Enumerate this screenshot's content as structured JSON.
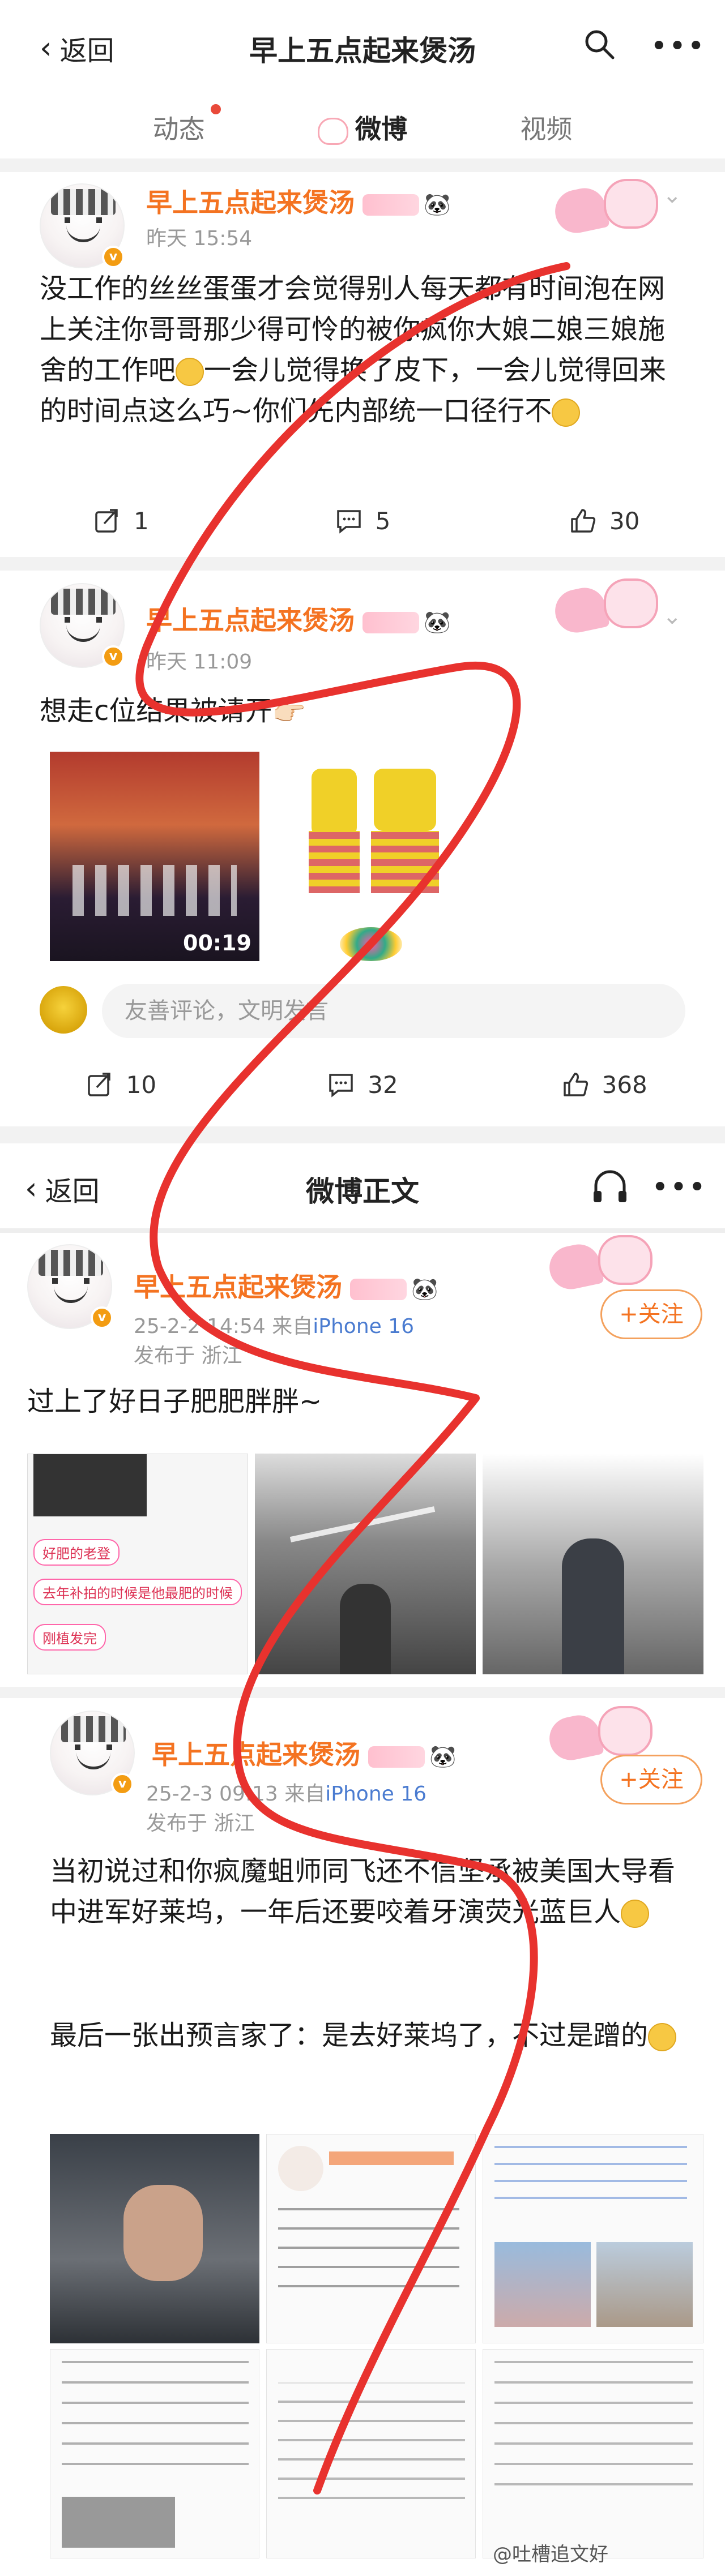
{
  "topbar": {
    "back_label": "返回",
    "title": "早上五点起来煲汤"
  },
  "tabs": [
    "动态",
    "微博",
    "视频"
  ],
  "posts": [
    {
      "author": "早上五点起来煲汤",
      "time": "昨天 15:54",
      "text": "没工作的丝丝蛋蛋才会觉得别人每天都有时间泡在网上关注你哥哥那少得可怜的被你疯你大娘二娘三娘施舍的工作吧",
      "text2": "一会儿觉得换了皮下，一会儿觉得回来的时间点这么巧~你们先内部统一口径行不",
      "reposts": "1",
      "comments": "5",
      "likes": "30"
    },
    {
      "author": "早上五点起来煲汤",
      "time": "昨天 11:09",
      "text": "想走c位结果被请开",
      "video_duration": "00:19",
      "comment_placeholder": "友善评论，文明发言",
      "reposts": "10",
      "comments": "32",
      "likes": "368"
    }
  ],
  "detail": {
    "back_label": "返回",
    "title": "微博正文"
  },
  "detail_posts": [
    {
      "author": "早上五点起来煲汤",
      "time": "25-2-2 14:54",
      "device_prefix": "来自",
      "device": "iPhone 16",
      "location": "发布于 浙江",
      "follow": "+关注",
      "text": "过上了好日子肥肥胖胖~",
      "img_labels": [
        "好肥的老登",
        "去年补拍的时候是他最肥的时候",
        "刚植发完"
      ]
    },
    {
      "author": "早上五点起来煲汤",
      "time": "25-2-3 09:13",
      "device_prefix": "来自",
      "device": "iPhone 16",
      "location": "发布于 浙江",
      "follow": "+关注",
      "text": "当初说过和你疯魔蛆师同飞还不信坚承被美国大导看中进军好莱坞，一年后还要咬着牙演荧光蓝巨人",
      "text2": "最后一张出预言家了：是去好莱坞了，不过是蹭的"
    }
  ],
  "watermark": "@吐槽追文好"
}
